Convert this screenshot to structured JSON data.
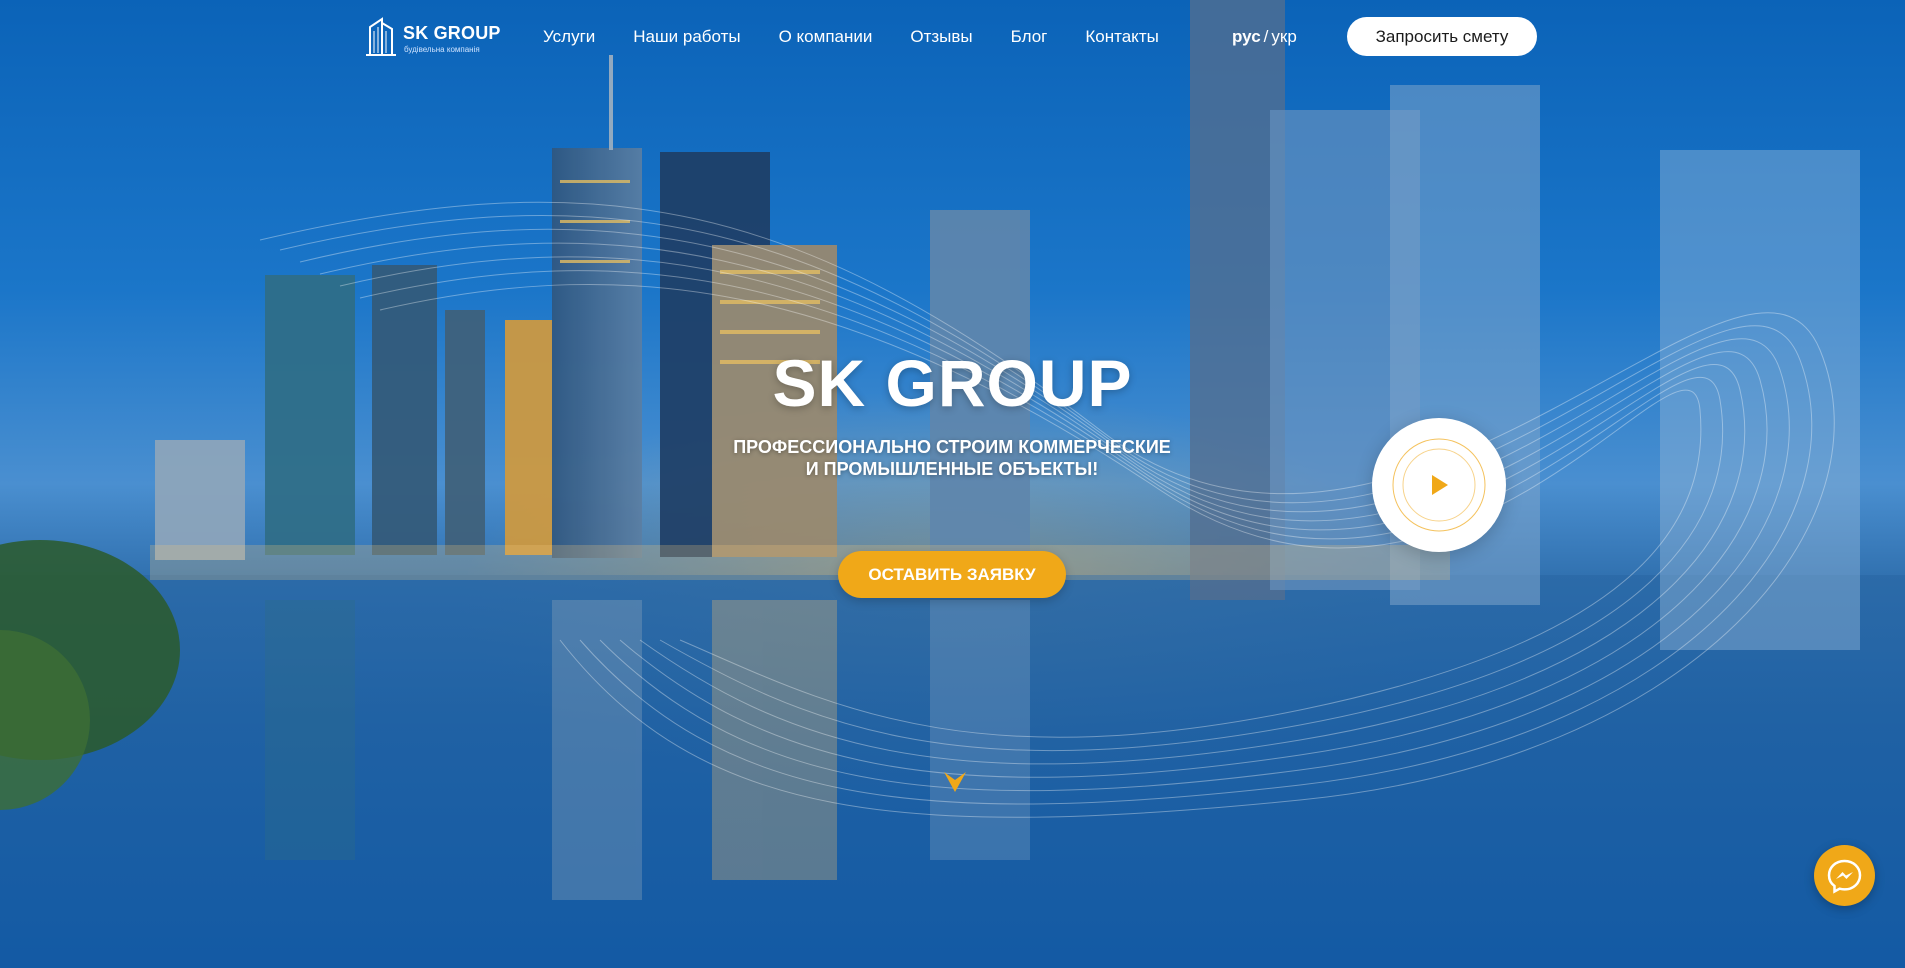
{
  "header": {
    "logo": {
      "title": "SK GROUP",
      "subtitle": "будівельна компанія",
      "icon": "building-icon"
    },
    "nav": [
      {
        "label": "Услуги"
      },
      {
        "label": "Наши работы"
      },
      {
        "label": "О компании"
      },
      {
        "label": "Отзывы"
      },
      {
        "label": "Блог"
      },
      {
        "label": "Контакты"
      }
    ],
    "lang": {
      "active": "рус",
      "separator": "/",
      "other": "укр"
    },
    "estimate_button": "Запросить смету"
  },
  "hero": {
    "title": "SK GROUP",
    "subtitle_line1": "ПРОФЕССИОНАЛЬНО СТРОИМ КОММЕРЧЕСКИЕ",
    "subtitle_line2": "И ПРОМЫШЛЕННЫЕ ОБЪЕКТЫ!",
    "cta_button": "ОСТАВИТЬ ЗАЯВКУ",
    "play_icon": "play-icon",
    "scroll_icon": "chevron-down-icon"
  },
  "widgets": {
    "messenger_icon": "messenger-icon"
  },
  "colors": {
    "accent": "#f0a818",
    "button_bg": "#ffffff",
    "sky": "#0b63b8"
  }
}
